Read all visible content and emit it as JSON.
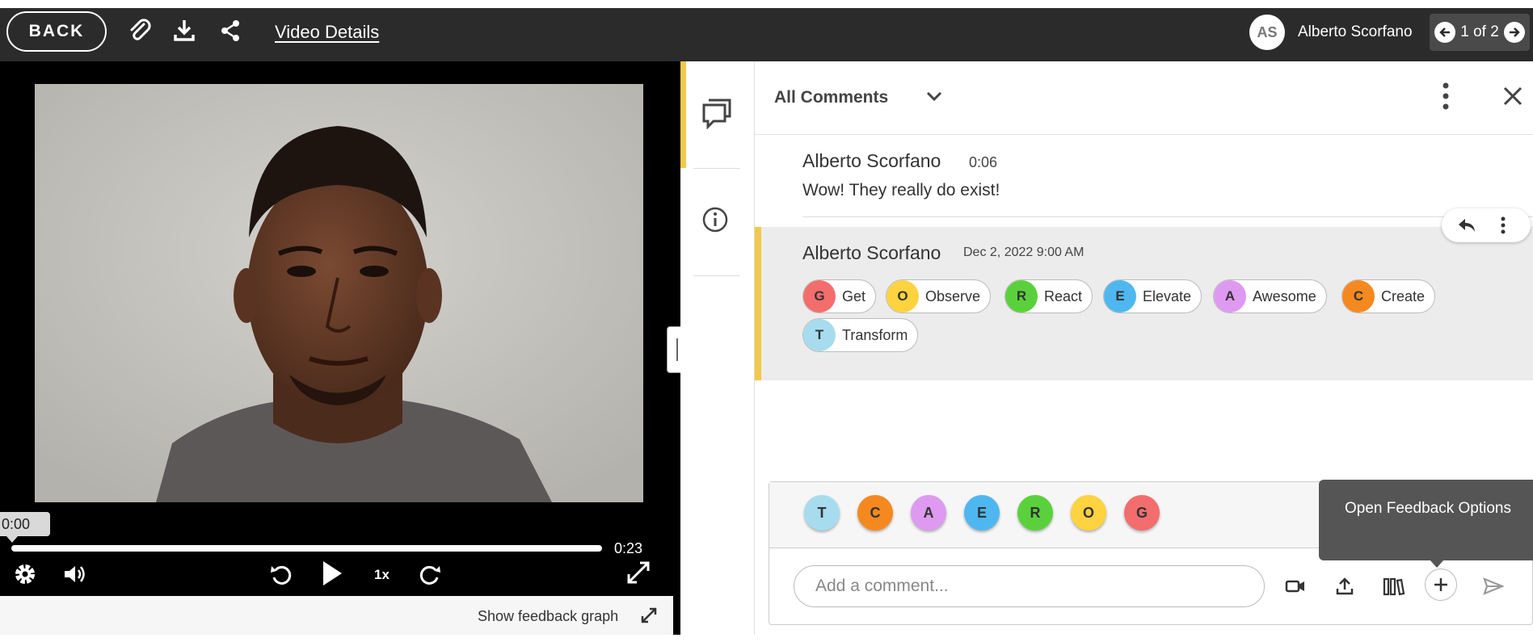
{
  "header": {
    "back_label": "BACK",
    "video_details_label": "Video Details",
    "user_initials": "AS",
    "user_name": "Alberto Scorfano",
    "pager_text": "1 of 2"
  },
  "player": {
    "current_time": "0:00",
    "duration": "0:23",
    "progress_fraction": 0.0,
    "speed_label": "1x",
    "show_graph_label": "Show feedback graph"
  },
  "comments_panel": {
    "filter_label": "All Comments",
    "comments": [
      {
        "author": "Alberto Scorfano",
        "timestamp": "0:06",
        "text": "Wow!  They really do exist!"
      },
      {
        "author": "Alberto Scorfano",
        "timestamp": "Dec 2, 2022 9:00 AM",
        "tags": [
          {
            "letter": "G",
            "label": "Get",
            "color": "#f36d6d"
          },
          {
            "letter": "O",
            "label": "Observe",
            "color": "#ffd23f"
          },
          {
            "letter": "R",
            "label": "React",
            "color": "#5ad13c"
          },
          {
            "letter": "E",
            "label": "Elevate",
            "color": "#4fb7f0"
          },
          {
            "letter": "A",
            "label": "Awesome",
            "color": "#dd9af0"
          },
          {
            "letter": "C",
            "label": "Create",
            "color": "#f5891f"
          },
          {
            "letter": "T",
            "label": "Transform",
            "color": "#a7dcef"
          }
        ]
      }
    ]
  },
  "composer": {
    "quick_tags": [
      {
        "letter": "T",
        "color": "#a7dcef"
      },
      {
        "letter": "C",
        "color": "#f5891f"
      },
      {
        "letter": "A",
        "color": "#dd9af0"
      },
      {
        "letter": "E",
        "color": "#4fb7f0"
      },
      {
        "letter": "R",
        "color": "#5ad13c"
      },
      {
        "letter": "O",
        "color": "#ffd23f"
      },
      {
        "letter": "G",
        "color": "#f36d6d"
      }
    ],
    "placeholder": "Add a comment...",
    "tooltip": "Open Feedback Options"
  },
  "colors": {
    "accent": "#f2c94c",
    "topbar": "#2b2b2b"
  }
}
